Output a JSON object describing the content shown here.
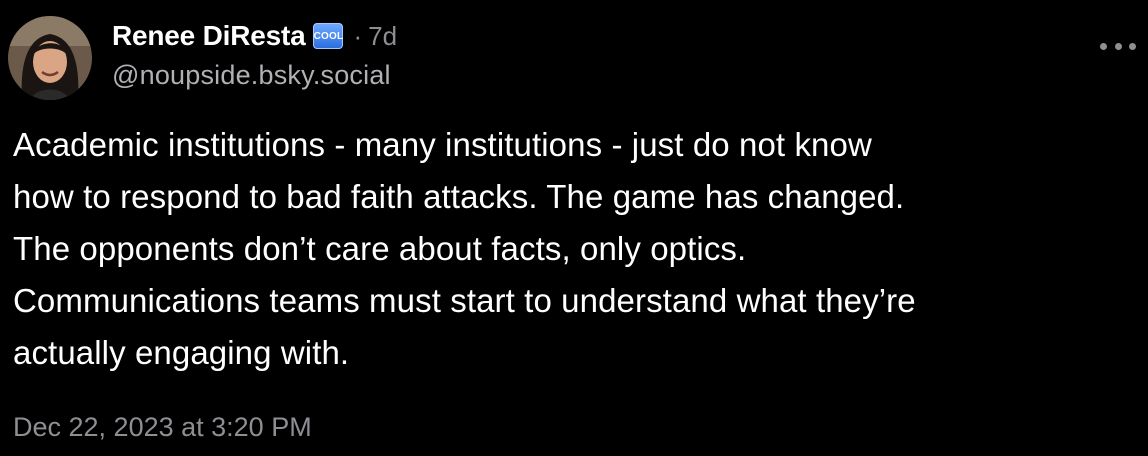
{
  "author": {
    "display_name": "Renee DiResta",
    "badge_icon": "cool-button-icon",
    "badge_text": "COOL",
    "separator": "·",
    "time_ago": "7d",
    "handle": "@noupside.bsky.social"
  },
  "post": {
    "lines": [
      "Academic institutions - many institutions - just do not know",
      "how to respond to bad faith attacks. The game has changed.",
      "The opponents don’t care about facts, only optics.",
      "Communications teams must start to understand what they’re",
      "actually engaging with."
    ],
    "timestamp": "Dec 22, 2023 at 3:20 PM"
  },
  "colors": {
    "background": "#000000",
    "text": "#ffffff",
    "muted": "#8e8e93"
  }
}
